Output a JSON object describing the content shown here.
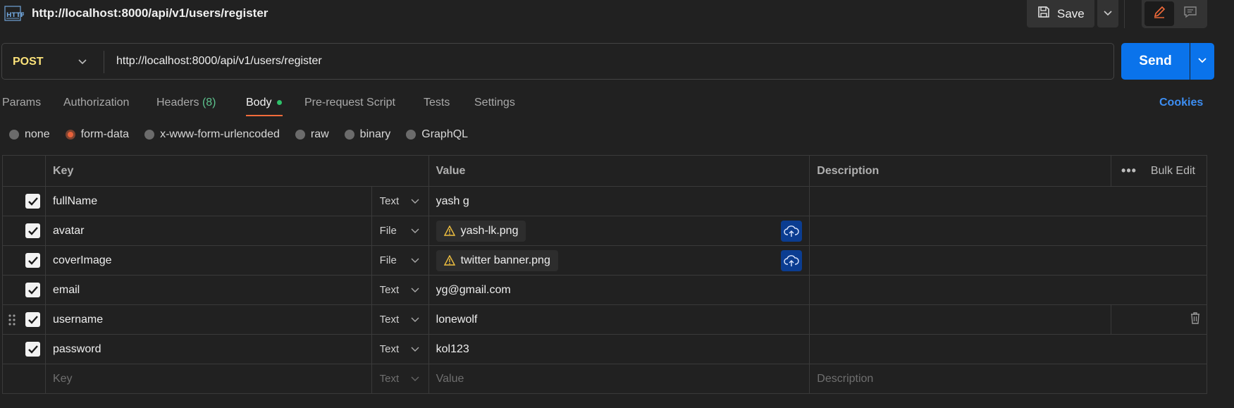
{
  "header": {
    "icon": "http-icon",
    "title": "http://localhost:8000/api/v1/users/register",
    "save_label": "Save"
  },
  "request": {
    "method": "POST",
    "url": "http://localhost:8000/api/v1/users/register",
    "send_label": "Send"
  },
  "tabs": [
    {
      "label": "Params"
    },
    {
      "label": "Authorization"
    },
    {
      "label": "Headers",
      "count": "(8)"
    },
    {
      "label": "Body",
      "active": true
    },
    {
      "label": "Pre-request Script"
    },
    {
      "label": "Tests"
    },
    {
      "label": "Settings"
    }
  ],
  "cookies_label": "Cookies",
  "body_modes": [
    {
      "label": "none",
      "selected": false
    },
    {
      "label": "form-data",
      "selected": true
    },
    {
      "label": "x-www-form-urlencoded",
      "selected": false
    },
    {
      "label": "raw",
      "selected": false
    },
    {
      "label": "binary",
      "selected": false
    },
    {
      "label": "GraphQL",
      "selected": false
    }
  ],
  "table": {
    "headers": {
      "key": "Key",
      "value": "Value",
      "description": "Description",
      "bulk_edit": "Bulk Edit"
    },
    "rows": [
      {
        "checked": true,
        "key": "fullName",
        "type": "Text",
        "value": "yash g",
        "description": ""
      },
      {
        "checked": true,
        "key": "avatar",
        "type": "File",
        "value": "yash-lk.png",
        "description": ""
      },
      {
        "checked": true,
        "key": "coverImage",
        "type": "File",
        "value": "twitter banner.png",
        "description": ""
      },
      {
        "checked": true,
        "key": "email",
        "type": "Text",
        "value": "yg@gmail.com",
        "description": ""
      },
      {
        "checked": true,
        "key": "username",
        "type": "Text",
        "value": "lonewolf",
        "description": ""
      },
      {
        "checked": true,
        "key": "password",
        "type": "Text",
        "value": "kol123",
        "description": ""
      }
    ],
    "new_row": {
      "key_placeholder": "Key",
      "type": "Text",
      "value_placeholder": "Value",
      "description_placeholder": "Description"
    }
  },
  "colors": {
    "accent_orange": "#f26b3a",
    "send_blue": "#0a73eb",
    "method_yellow": "#fbe27a",
    "cookies_blue": "#3d8ef2"
  }
}
